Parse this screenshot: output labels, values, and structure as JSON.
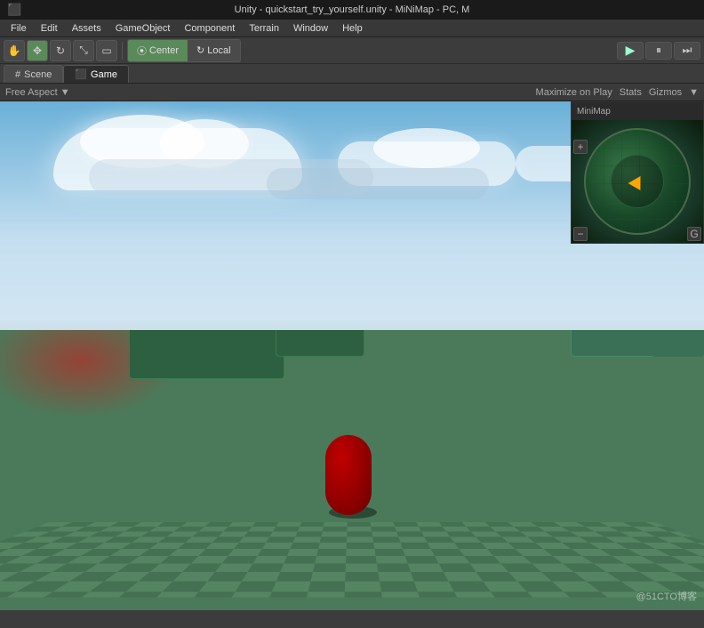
{
  "titlebar": {
    "title": "Unity - quickstart_try_yourself.unity - MiNiMap - PC, M"
  },
  "menubar": {
    "items": [
      "File",
      "Edit",
      "Assets",
      "GameObject",
      "Component",
      "Terrain",
      "Window",
      "Help"
    ]
  },
  "toolbar": {
    "tools": [
      "hand",
      "move",
      "rotate",
      "scale"
    ],
    "pivot_options": [
      "Center",
      "Local"
    ],
    "pivot_labels": {
      "center": "⦿ Center",
      "local": "↻ Local"
    }
  },
  "playcontrols": {
    "play": "▶",
    "pause": "⏸",
    "step": "⏭"
  },
  "tabs": {
    "scene_label": "# Scene",
    "game_label": "⬛ Game"
  },
  "gameview": {
    "top_labels": [
      "Maximize on Play",
      "Stats",
      "Gizmos",
      "▼"
    ],
    "aspect": "Free Aspect",
    "aspect_arrow": "▼"
  },
  "minimap": {
    "title": "MiniMap",
    "plus": "+",
    "minus": "−",
    "lock_icon": "G"
  },
  "watermark": {
    "text": "@51CTO博客"
  },
  "colors": {
    "bg": "#3c3c3c",
    "menubar": "#383838",
    "active_tab": "#2d2d2d",
    "ground": "#4a7a5a",
    "sky_top": "#6ab0d8",
    "sky_bottom": "#ddeaf5",
    "box_color": "#3a6a45",
    "player": "#8b0000",
    "minimap_bg": "#1a3a2a"
  }
}
